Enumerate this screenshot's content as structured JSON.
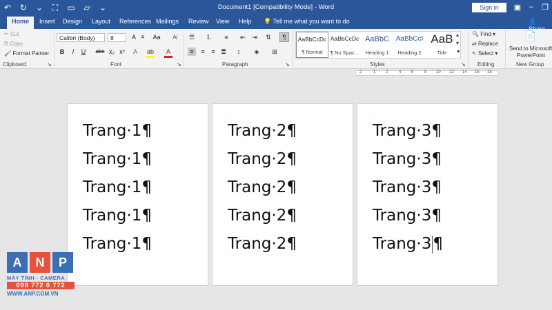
{
  "titlebar": {
    "document_title": "Document1 [Compatibility Mode] - Word",
    "sign_in": "Sign in"
  },
  "tabs": {
    "items": [
      "Home",
      "Insert",
      "Design",
      "Layout",
      "References",
      "Mailings",
      "Review",
      "View",
      "Help"
    ],
    "tell_me": "Tell me what you want to do",
    "share": "Share"
  },
  "ribbon": {
    "clipboard": {
      "cut": "Cut",
      "copy": "Copy",
      "format_painter": "Format Painter",
      "label": "Clipboard"
    },
    "font": {
      "family": "Calibri (Body)",
      "size": "8",
      "grow": "A",
      "shrink": "A",
      "case": "Aa",
      "bold": "B",
      "italic": "I",
      "underline": "U",
      "strike": "abc",
      "sub": "x₂",
      "sup": "x²",
      "label": "Font"
    },
    "paragraph": {
      "show_hide": "¶",
      "label": "Paragraph"
    },
    "styles": {
      "items": [
        {
          "preview": "AaBbCcDc",
          "name": "¶ Normal"
        },
        {
          "preview": "AaBbCcDc",
          "name": "¶ No Spac..."
        },
        {
          "preview": "AaBbC",
          "name": "Heading 1"
        },
        {
          "preview": "AaBbCcI",
          "name": "Heading 2"
        },
        {
          "preview": "AaB",
          "name": "Title"
        }
      ],
      "label": "Styles"
    },
    "editing": {
      "find": "Find",
      "replace": "Replace",
      "select": "Select",
      "label": "Editing"
    },
    "new_group": {
      "send_line1": "Send to Microsoft",
      "send_line2": "PowerPoint",
      "label": "New Group"
    }
  },
  "ruler": {
    "ticks": [
      "2",
      "1",
      "2",
      "4",
      "6",
      "8",
      "10",
      "12",
      "14",
      "16",
      "18"
    ]
  },
  "pages": [
    {
      "lines": [
        "Trang·1¶",
        "Trang·1¶",
        "Trang·1¶",
        "Trang·1¶",
        "Trang·1¶"
      ]
    },
    {
      "lines": [
        "Trang·2¶",
        "Trang·2¶",
        "Trang·2¶",
        "Trang·2¶",
        "Trang·2¶"
      ]
    },
    {
      "lines": [
        "Trang·3¶",
        "Trang·3¶",
        "Trang·3¶",
        "Trang·3¶",
        "Trang·3"
      ],
      "last_mark": "¶"
    }
  ],
  "watermark": {
    "letters": [
      "A",
      "N",
      "P"
    ],
    "colors": [
      "#3a6fb5",
      "#e5533d",
      "#3a6fb5"
    ],
    "tagline": "MÁY TÍNH - CAMERA",
    "phone": "098 772 0 772",
    "site": "WWW.ANP.COM.VN"
  },
  "colors": {
    "accent": "#2b579a"
  }
}
